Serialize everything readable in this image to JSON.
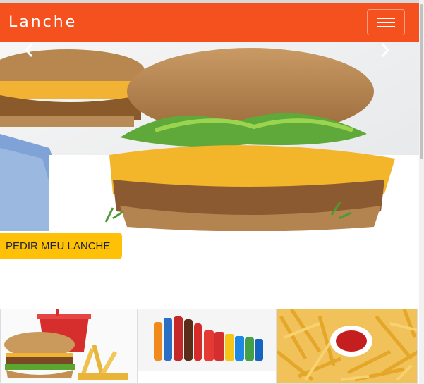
{
  "navbar": {
    "brand": "Lanche",
    "menu_icon": "hamburger-menu-icon"
  },
  "carousel": {
    "prev_icon": "chevron-left-icon",
    "next_icon": "chevron-right-icon",
    "image": "burger-photo"
  },
  "cta": {
    "label": "PEDIR MEU LANCHE"
  },
  "cards": [
    {
      "image": "burger-combo-photo"
    },
    {
      "image": "soft-drinks-photo"
    },
    {
      "image": "french-fries-photo"
    }
  ],
  "colors": {
    "navbar": "#f4511e",
    "cta": "#ffc107"
  }
}
